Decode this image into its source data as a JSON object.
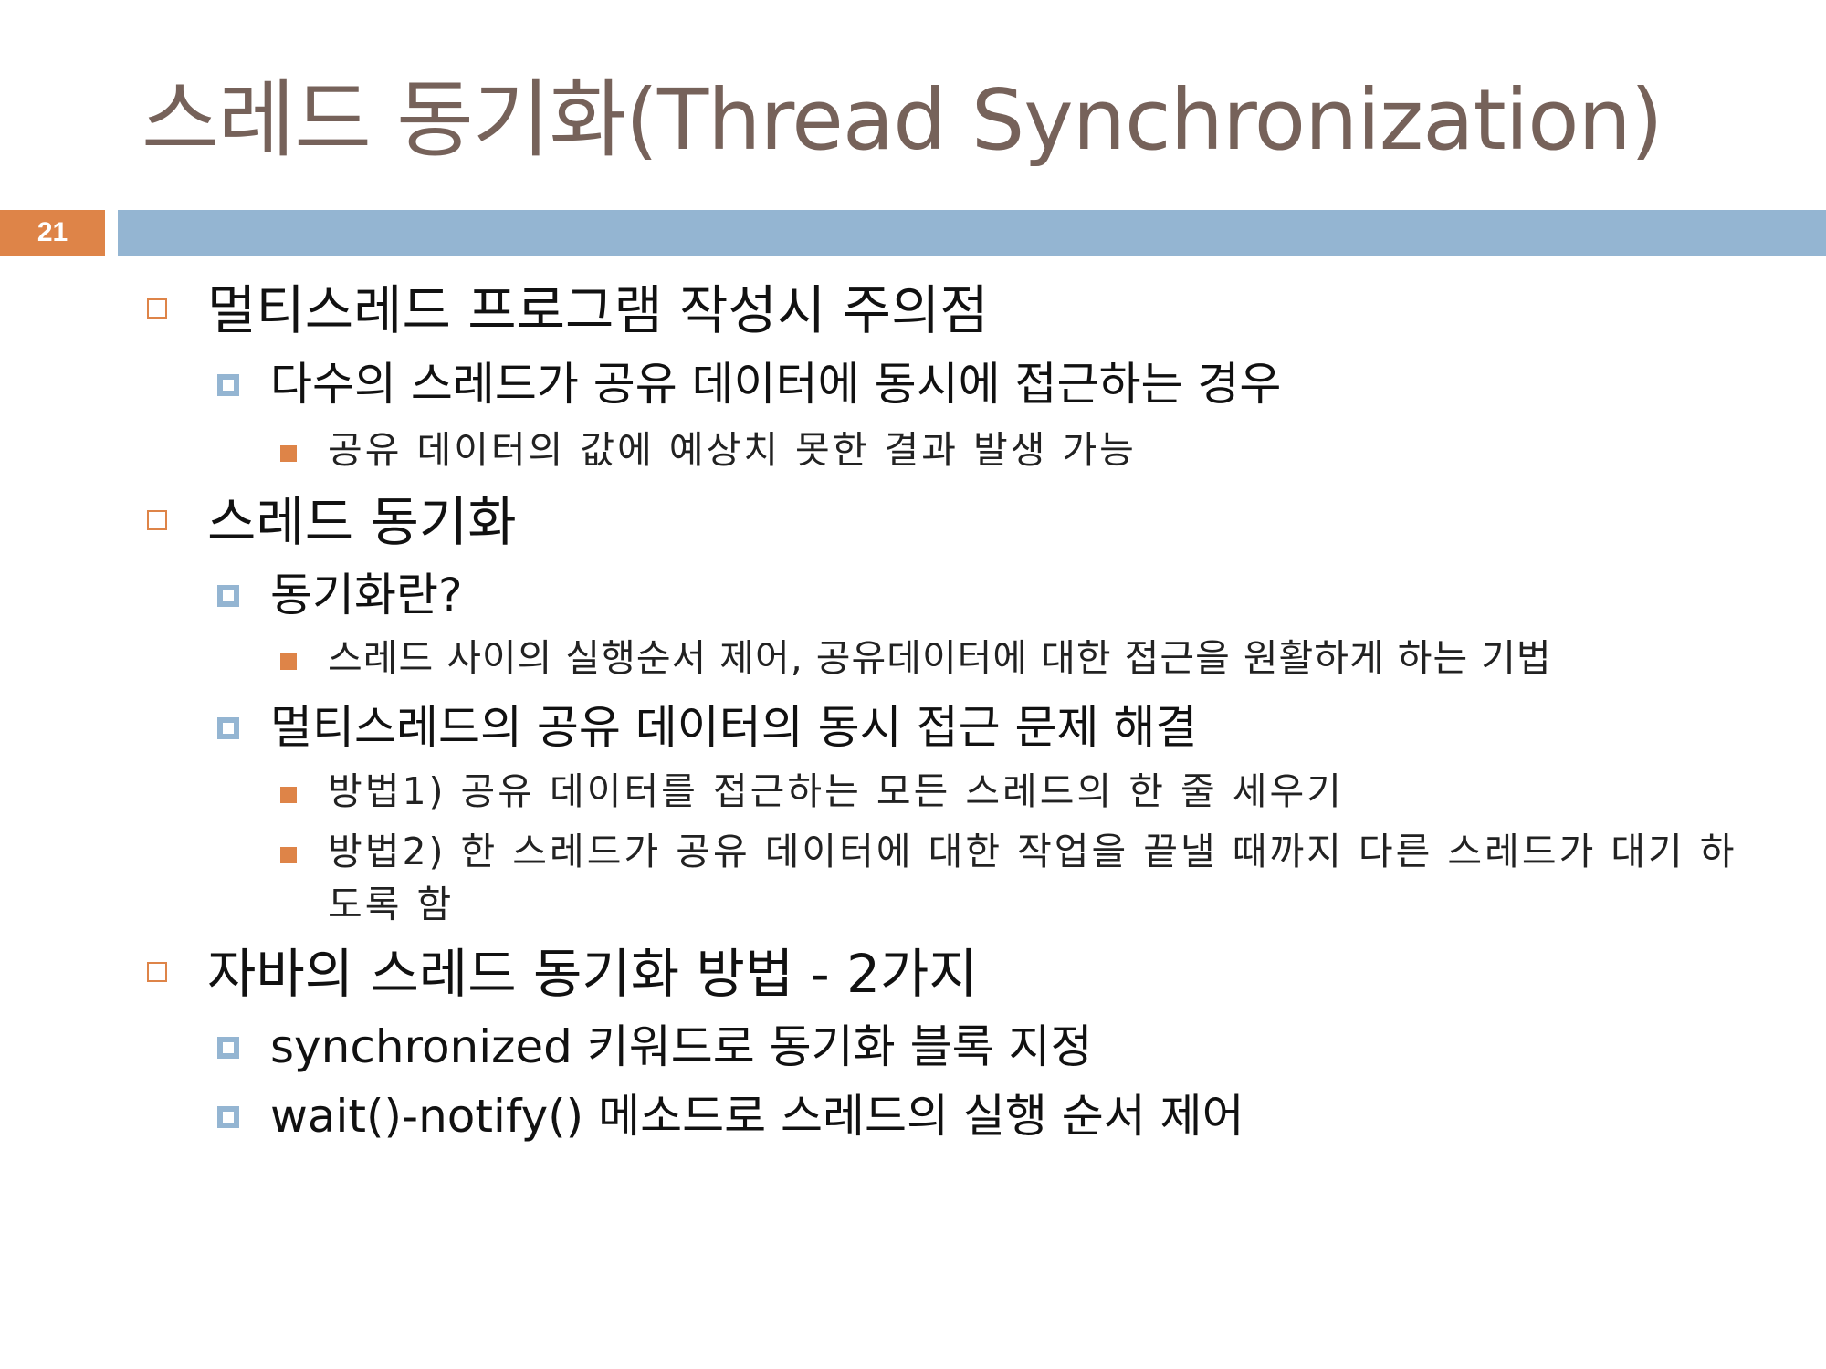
{
  "slide": {
    "title": "스레드 동기화(Thread Synchronization)",
    "page_number": "21"
  },
  "content": {
    "items": [
      {
        "level": 1,
        "text": "멀티스레드 프로그램 작성시 주의점"
      },
      {
        "level": 2,
        "text": "다수의 스레드가 공유 데이터에 동시에 접근하는 경우"
      },
      {
        "level": 3,
        "text": "공유 데이터의 값에 예상치 못한 결과 발생 가능"
      },
      {
        "level": 1,
        "text": "스레드 동기화"
      },
      {
        "level": 2,
        "text": "동기화란?"
      },
      {
        "level": 3,
        "text": "스레드 사이의 실행순서 제어, 공유데이터에 대한 접근을 원활하게 하는 기법"
      },
      {
        "level": 2,
        "text": "멀티스레드의 공유 데이터의 동시 접근 문제 해결"
      },
      {
        "level": 3,
        "text": "방법1) 공유 데이터를 접근하는 모든 스레드의 한 줄 세우기"
      },
      {
        "level": 3,
        "text": "방법2) 한 스레드가 공유 데이터에 대한 작업을 끝낼 때까지 다른 스레드가 대기 하도록 함"
      },
      {
        "level": 1,
        "text": "자바의 스레드 동기화 방법 - 2가지"
      },
      {
        "level": 2,
        "text": "synchronized 키워드로 동기화 블록 지정"
      },
      {
        "level": 2,
        "text": "wait()-notify() 메소드로 스레드의 실행 순서 제어"
      }
    ]
  },
  "colors": {
    "title": "#76625a",
    "accent_orange": "#de8448",
    "accent_blue": "#94b5d2"
  }
}
